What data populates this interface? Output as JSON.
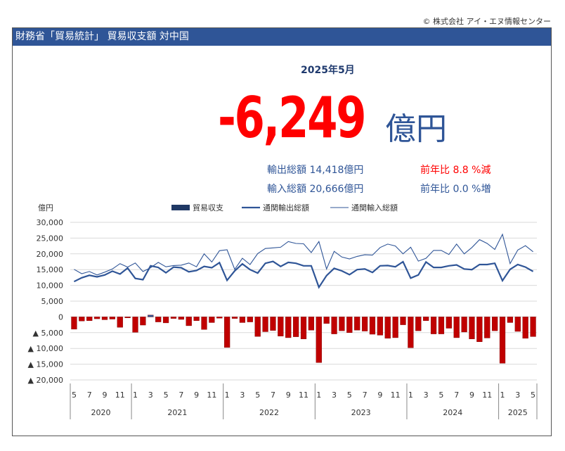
{
  "copyright": "© 株式会社 アイ・エヌ情報センター",
  "banner_title": "財務省「貿易統計」 貿易収支額 対中国",
  "period": "2025年5月",
  "headline": {
    "value": "-6,249",
    "unit": "億円"
  },
  "stats": {
    "export_label": "輸出総額 14,418億円",
    "import_label": "輸入総額 20,666億円",
    "export_yoy": "前年比 8.8 %減",
    "import_yoy": "前年比 0.0 %増"
  },
  "colors": {
    "banner": "#2f5597",
    "bar": "#c00000",
    "bar_positive": "#2f5597",
    "export_line": "#2f5597",
    "import_line": "#2f5597",
    "headline": "#ff0000"
  },
  "chart_data": {
    "type": "bar",
    "ylabel": "億円",
    "ylim": [
      -20000,
      30000
    ],
    "yticks": [
      30000,
      25000,
      20000,
      15000,
      10000,
      5000,
      0,
      -5000,
      -10000,
      -15000,
      -20000
    ],
    "ytick_labels": [
      "30,000",
      "25,000",
      "20,000",
      "15,000",
      "10,000",
      "5,000",
      "0",
      "▲ 5,000",
      "▲ 10,000",
      "▲ 15,000",
      "▲ 20,000"
    ],
    "legend": [
      "貿易収支",
      "通関輸出総額",
      "通関輸入総額"
    ],
    "legend_position": "top",
    "grid": true,
    "months_labels": [
      "5",
      "7",
      "9",
      "11",
      "1",
      "3",
      "5",
      "7",
      "9",
      "11",
      "1",
      "3",
      "5",
      "7",
      "9",
      "11",
      "1",
      "3",
      "5",
      "7",
      "9",
      "11",
      "1",
      "3",
      "5",
      "7",
      "9",
      "11",
      "1",
      "3",
      "5"
    ],
    "years": [
      {
        "label": "2020",
        "start": 0,
        "count": 8
      },
      {
        "label": "2021",
        "start": 8,
        "count": 12
      },
      {
        "label": "2022",
        "start": 20,
        "count": 12
      },
      {
        "label": "2023",
        "start": 32,
        "count": 12
      },
      {
        "label": "2024",
        "start": 44,
        "count": 12
      },
      {
        "label": "2025",
        "start": 56,
        "count": 5
      }
    ],
    "x": [
      "2020-05",
      "2020-06",
      "2020-07",
      "2020-08",
      "2020-09",
      "2020-10",
      "2020-11",
      "2020-12",
      "2021-01",
      "2021-02",
      "2021-03",
      "2021-04",
      "2021-05",
      "2021-06",
      "2021-07",
      "2021-08",
      "2021-09",
      "2021-10",
      "2021-11",
      "2021-12",
      "2022-01",
      "2022-02",
      "2022-03",
      "2022-04",
      "2022-05",
      "2022-06",
      "2022-07",
      "2022-08",
      "2022-09",
      "2022-10",
      "2022-11",
      "2022-12",
      "2023-01",
      "2023-02",
      "2023-03",
      "2023-04",
      "2023-05",
      "2023-06",
      "2023-07",
      "2023-08",
      "2023-09",
      "2023-10",
      "2023-11",
      "2023-12",
      "2024-01",
      "2024-02",
      "2024-03",
      "2024-04",
      "2024-05",
      "2024-06",
      "2024-07",
      "2024-08",
      "2024-09",
      "2024-10",
      "2024-11",
      "2024-12",
      "2025-01",
      "2025-02",
      "2025-03",
      "2025-04",
      "2025-05"
    ],
    "series": [
      {
        "name": "貿易収支",
        "type": "bar",
        "values": [
          -3900,
          -1300,
          -1200,
          -600,
          -900,
          -700,
          -3300,
          -300,
          -4900,
          -2600,
          600,
          -1600,
          -1900,
          -500,
          -800,
          -2800,
          -1200,
          -4000,
          -1800,
          -400,
          -9700,
          -500,
          -1800,
          -1600,
          -6200,
          -4700,
          -4300,
          -6100,
          -6600,
          -6300,
          -7000,
          -4200,
          -14500,
          -2100,
          -5400,
          -4400,
          -5000,
          -4200,
          -4500,
          -5500,
          -5800,
          -6800,
          -6600,
          -2500,
          -9800,
          -4400,
          -1200,
          -5400,
          -5400,
          -3600,
          -6600,
          -4800,
          -7000,
          -7900,
          -6700,
          -4400,
          -14700,
          -1800,
          -4600,
          -6800,
          -6249
        ]
      },
      {
        "name": "通関輸出総額",
        "type": "line",
        "values": [
          11200,
          12400,
          13200,
          12700,
          13300,
          14500,
          13600,
          15500,
          12200,
          11800,
          16200,
          15700,
          14000,
          15800,
          15600,
          14300,
          14700,
          16000,
          15600,
          17200,
          11600,
          14600,
          16800,
          15000,
          13900,
          17000,
          17600,
          16000,
          17300,
          17000,
          16200,
          16200,
          9400,
          13100,
          15400,
          14600,
          13400,
          15000,
          15200,
          14100,
          16200,
          16300,
          15900,
          17500,
          12300,
          13300,
          17400,
          15700,
          15700,
          16200,
          16500,
          15200,
          15000,
          16600,
          16600,
          17000,
          11500,
          15100,
          16600,
          15800,
          14418
        ]
      },
      {
        "name": "通関輸入総額",
        "type": "line",
        "values": [
          15100,
          13700,
          14400,
          13300,
          14200,
          15200,
          16900,
          15800,
          17100,
          14400,
          15600,
          17300,
          15900,
          16300,
          16400,
          17100,
          15900,
          20000,
          17400,
          21000,
          21300,
          15100,
          18600,
          16600,
          20100,
          21700,
          21900,
          22100,
          23900,
          23300,
          23200,
          20400,
          23900,
          15200,
          20800,
          19000,
          18400,
          19200,
          19700,
          19600,
          22000,
          23100,
          22500,
          20000,
          22100,
          17700,
          18600,
          21100,
          21100,
          19800,
          23100,
          20000,
          22000,
          24500,
          23300,
          21400,
          26200,
          16900,
          21200,
          22600,
          20666
        ]
      }
    ]
  }
}
